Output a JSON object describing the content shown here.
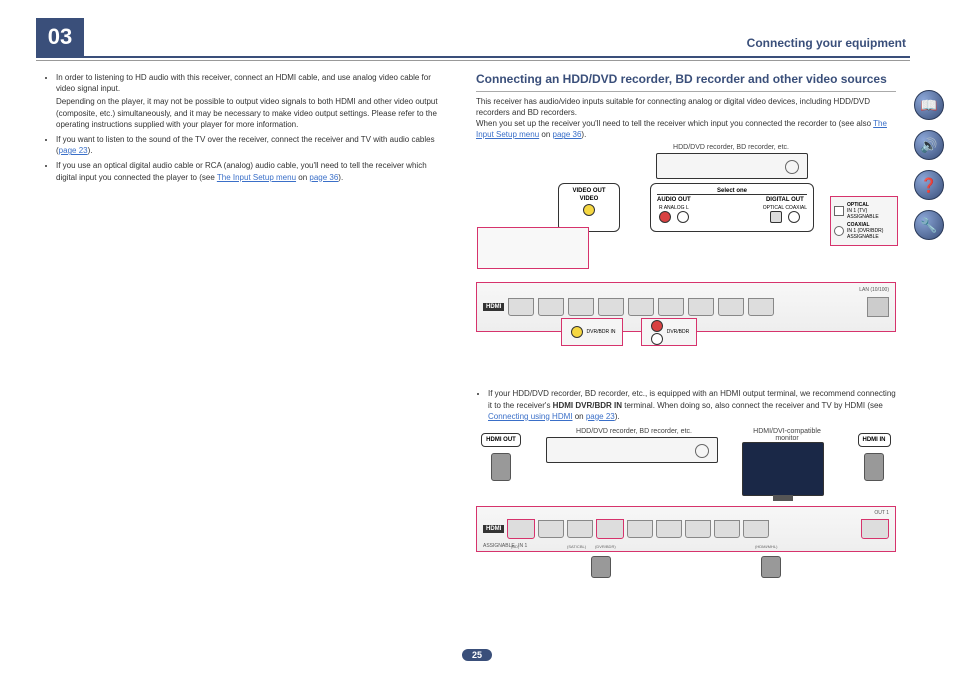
{
  "chapter": "03",
  "header_title": "Connecting your equipment",
  "page_number": "25",
  "left_column": {
    "b1": "In order to listening to HD audio with this receiver, connect an HDMI cable, and use analog video cable for video signal input.",
    "b1_sub": "Depending on the player, it may not be possible to output video signals to both HDMI and other video output (composite, etc.) simultaneously, and it may be necessary to make video output settings. Please refer to the operating instructions supplied with your player for more information.",
    "b2_a": "If you want to listen to the sound of the TV over the receiver, connect the receiver and TV with audio cables (",
    "b2_link": "page 23",
    "b2_b": ").",
    "b3_a": "If you use an optical digital audio cable or RCA (analog) audio cable, you'll need to tell the receiver which digital input you connected the player to (see ",
    "b3_link": "The Input Setup menu",
    "b3_on": " on ",
    "b3_page": "page 36",
    "b3_b": ")."
  },
  "section_title": "Connecting an HDD/DVD recorder, BD recorder and other video sources",
  "intro1": "This receiver has audio/video inputs suitable for connecting analog or digital video devices, including HDD/DVD recorders and BD recorders.",
  "intro2_a": "When you set up the receiver you'll need to tell the receiver which input you connected the recorder to (see also ",
  "intro2_link": "The Input Setup menu",
  "intro2_on": " on ",
  "intro2_page": "page 36",
  "intro2_b": ").",
  "diagram1": {
    "device_label": "HDD/DVD recorder, BD recorder, etc.",
    "video_out": "VIDEO OUT",
    "video": "VIDEO",
    "select_one": "Select one",
    "audio_out": "AUDIO OUT",
    "digital_out": "DIGITAL OUT",
    "analog_r": "R",
    "analog": "ANALOG",
    "analog_l": "L",
    "optical": "OPTICAL",
    "coaxial": "COAXIAL",
    "hdmi": "HDMI",
    "lan": "LAN (10/100)",
    "side_optical": "OPTICAL",
    "side_in1": "IN 1 (TV)",
    "side_assignable": "ASSIGNABLE",
    "side_coaxial": "COAXIAL",
    "side_in1_dvr": "IN 1 (DVR/BDR)",
    "dvr_bdr_in": "DVR/BDR IN",
    "dvr_bdr": "DVR/BDR"
  },
  "mid_bullet_a": "If your HDD/DVD recorder, BD recorder, etc., is equipped with an HDMI output terminal, we recommend connecting it to the receiver's ",
  "mid_bullet_bold": "HDMI DVR/BDR IN",
  "mid_bullet_b": " terminal. When doing so, also connect the receiver and TV by HDMI (see ",
  "mid_bullet_link": "Connecting using HDMI",
  "mid_bullet_on": " on ",
  "mid_bullet_page": "page 23",
  "mid_bullet_c": ").",
  "diagram2": {
    "device_label": "HDD/DVD recorder, BD recorder, etc.",
    "monitor_label": "HDMI/DVI-compatible monitor",
    "hdmi_out": "HDMI OUT",
    "hdmi_in": "HDMI IN",
    "hdmi": "HDMI",
    "assignable": "ASSIGNABLE",
    "in1": "IN 1",
    "out1": "OUT 1",
    "port1": "(BD)",
    "port3": "(SAT/CBL)",
    "port4": "(DVR/BDR)",
    "port9": "(HDMI/MHL)"
  },
  "side_icons": {
    "book": "📖",
    "speaker": "🔊",
    "help": "❓",
    "wrench": "🔧"
  }
}
